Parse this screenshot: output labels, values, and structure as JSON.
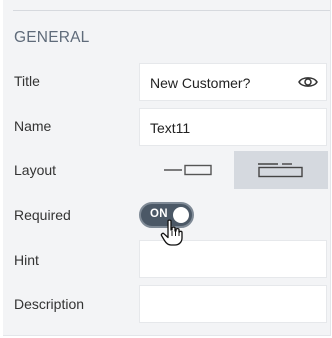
{
  "section": {
    "title": "GENERAL"
  },
  "fields": {
    "title_label": "Title",
    "title_value": "New Customer?",
    "name_label": "Name",
    "name_value": "Text11",
    "layout_label": "Layout",
    "required_label": "Required",
    "required_toggle": "ON",
    "hint_label": "Hint",
    "hint_value": "",
    "description_label": "Description",
    "description_value": ""
  },
  "icons": {
    "visibility": "eye-icon",
    "layout_option_1": "inline-layout-icon",
    "layout_option_2": "stacked-layout-icon",
    "cursor": "hand-pointer-cursor"
  },
  "colors": {
    "panel_bg": "#f3f4f6",
    "toggle_on": "#4b5866",
    "layout_selected": "#d5d9df",
    "section_title": "#5f6b7a"
  }
}
